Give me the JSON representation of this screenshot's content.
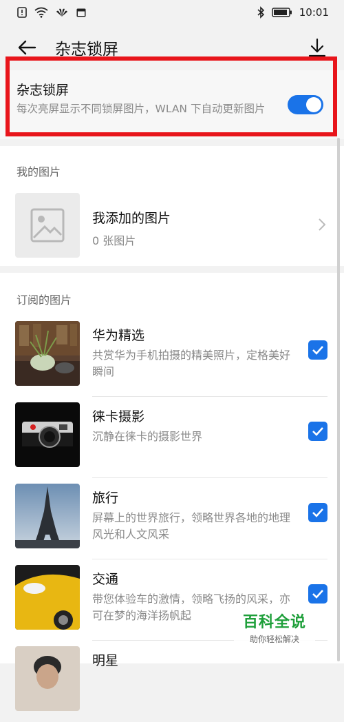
{
  "status_bar": {
    "time": "10:01",
    "icons_left": [
      "alert-icon",
      "wifi-icon",
      "huawei-logo-icon",
      "calendar-icon"
    ],
    "icons_right": [
      "bluetooth-icon",
      "battery-icon"
    ]
  },
  "app_bar": {
    "title": "杂志锁屏",
    "back_icon": "arrow-left-icon",
    "action_icon": "download-icon"
  },
  "magazine_toggle": {
    "title": "杂志锁屏",
    "description": "每次亮屏显示不同锁屏图片，WLAN 下自动更新图片",
    "enabled": true
  },
  "my_photos": {
    "section_title": "我的图片",
    "item_title": "我添加的图片",
    "item_count": "0 张图片"
  },
  "subscribed": {
    "section_title": "订阅的图片",
    "items": [
      {
        "title": "华为精选",
        "description": "共赏华为手机拍摄的精美照片，定格美好瞬间",
        "checked": true
      },
      {
        "title": "徕卡摄影",
        "description": "沉静在徕卡的摄影世界",
        "checked": true
      },
      {
        "title": "旅行",
        "description": "屏幕上的世界旅行，领略世界各地的地理风光和人文风采",
        "checked": true
      },
      {
        "title": "交通",
        "description": "带您体验车的激情，领略飞扬的风采，亦可在梦的海洋扬帆起",
        "checked": true
      },
      {
        "title": "明星",
        "description": "",
        "checked": true
      }
    ]
  },
  "watermark": {
    "title": "百科全说",
    "subtitle": "助你轻松解决"
  },
  "colors": {
    "accent": "#1a73e8",
    "highlight_border": "#e8151b",
    "watermark_green": "#1e9f3a"
  }
}
